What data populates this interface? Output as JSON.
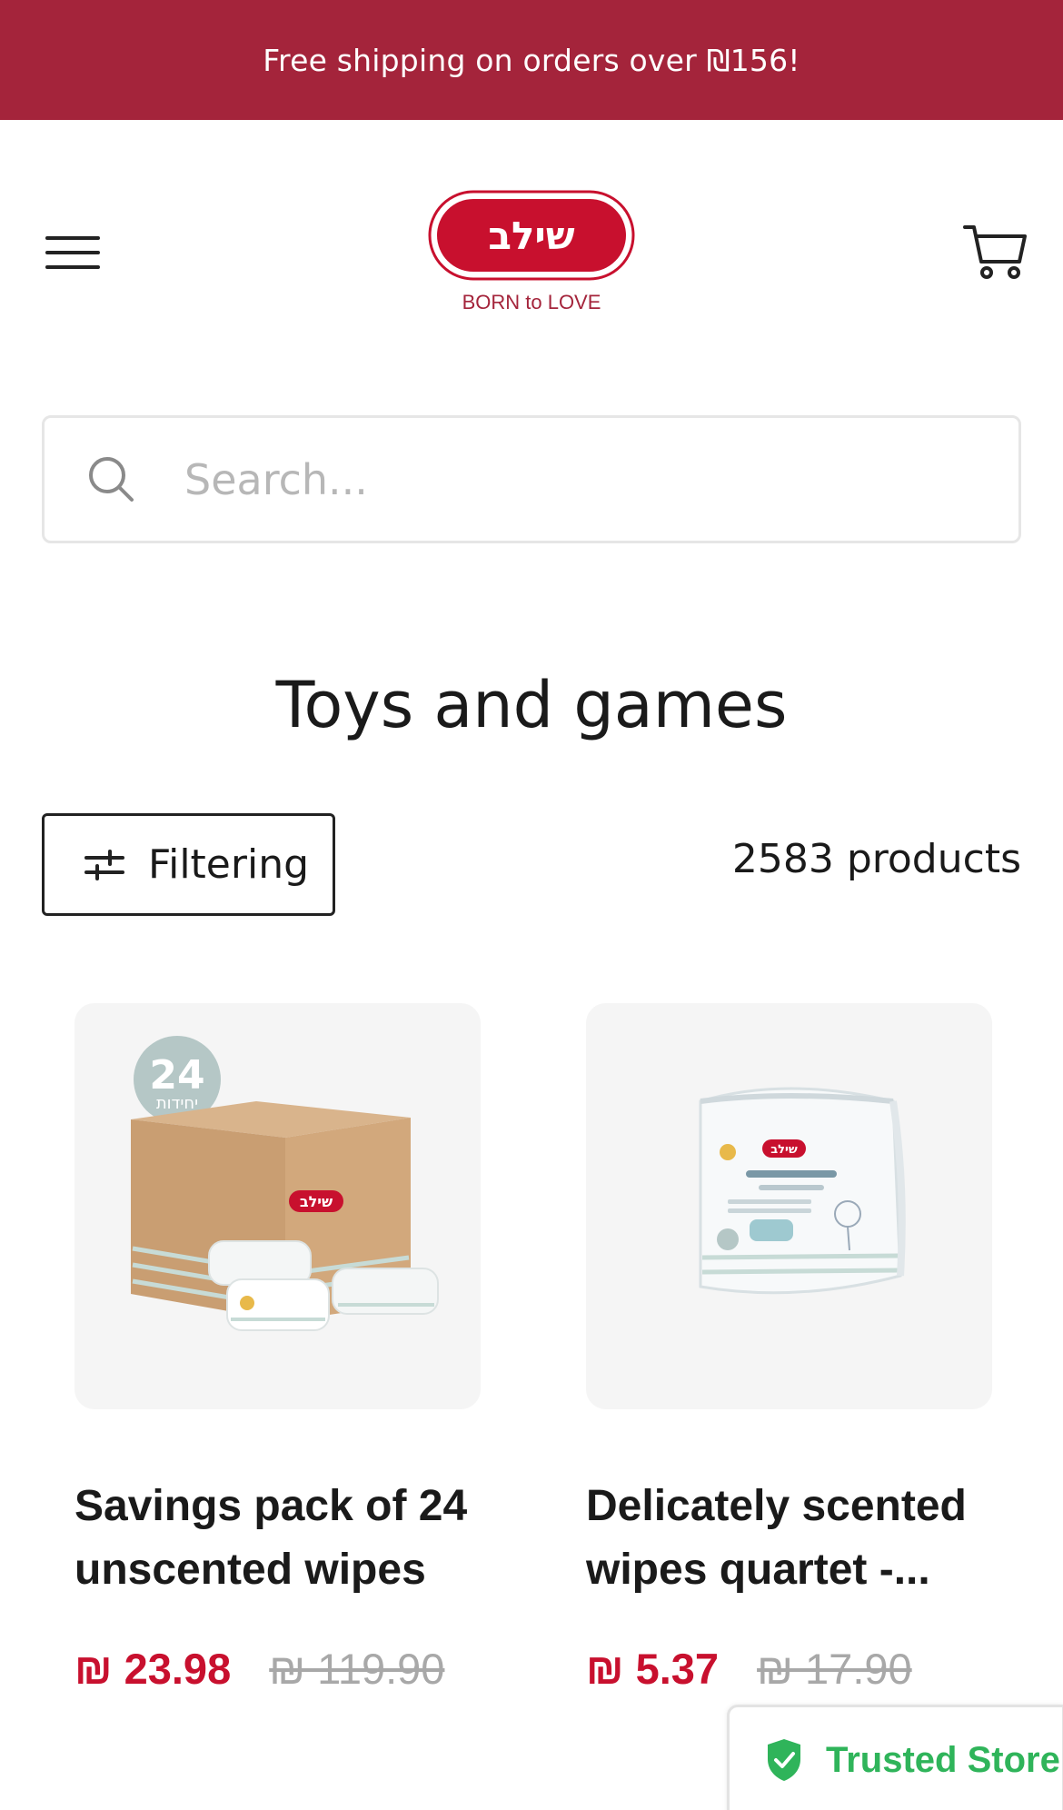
{
  "announcement": {
    "text": "Free shipping on orders over ₪156!"
  },
  "header": {
    "logo_text": "שילב",
    "logo_tagline": "BORN to LOVE",
    "menu_icon": "hamburger-menu-icon",
    "cart_icon": "shopping-cart-icon"
  },
  "search": {
    "placeholder": "Search...",
    "value": "",
    "icon": "search-icon"
  },
  "collection": {
    "title": "Toys and games",
    "filter_label": "Filtering",
    "product_count": "2583 products"
  },
  "products": [
    {
      "title": "Savings pack of 24 unscented wipes",
      "sale_price": "₪ 23.98",
      "original_price": "₪ 119.90",
      "badge_number": "24",
      "badge_text": "יחידות",
      "box_logo": "שילב"
    },
    {
      "title": "Delicately scented wipes quartet -...",
      "sale_price": "₪ 5.37",
      "original_price": "₪ 17.90",
      "pack_logo": "שילב"
    }
  ],
  "trust_badge": {
    "label": "Trusted Store",
    "icon": "shield-check-icon"
  },
  "colors": {
    "brand": "#a4243b",
    "logo_red": "#c8102e",
    "sale": "#c8102e",
    "trusted": "#2fb45a"
  }
}
